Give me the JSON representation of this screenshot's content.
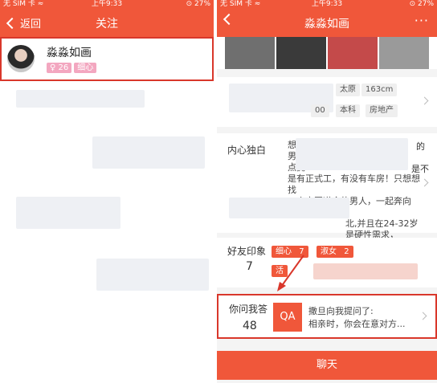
{
  "left_screen": {
    "status": {
      "carrier": "无 SIM 卡 ≈",
      "time": "上午9:33",
      "battery": "⊙ 27%"
    },
    "nav": {
      "back_label": "返回",
      "title": "关注"
    },
    "follow_item": {
      "name": "淼淼如画",
      "tags": [
        "♀ 26",
        "细心"
      ]
    }
  },
  "right_screen": {
    "status": {
      "carrier": "无 SIM 卡 ≈",
      "time": "上午9:33",
      "battery": "⊙ 27%"
    },
    "nav": {
      "title": "淼淼如画",
      "more": "···"
    },
    "info_tags": [
      "太原",
      "163cm",
      "00",
      "本科",
      "房地产"
    ],
    "inner": {
      "label": "内心独白",
      "lines": [
        "想",
        "男",
        "点拥",
        "是有正式工，有没有车房！只想想找",
        "一个志同道合的男人，一起奔向未...",
        "北,并且在24-32岁",
        "是硬性需求，"
      ],
      "snippet_right": [
        "的",
        "是不"
      ]
    },
    "friends": {
      "label": "好友印象",
      "count": "7",
      "tags": [
        {
          "text": "细心",
          "num": "7"
        },
        {
          "text": "淑女",
          "num": "2"
        },
        {
          "text": "活"
        }
      ]
    },
    "qa": {
      "label": "你问我答",
      "count": "48",
      "icon_text": "QA",
      "line1": "撒旦向我提问了:",
      "line2": "相亲时，你会在意对方..."
    },
    "chat_label": "聊天"
  }
}
